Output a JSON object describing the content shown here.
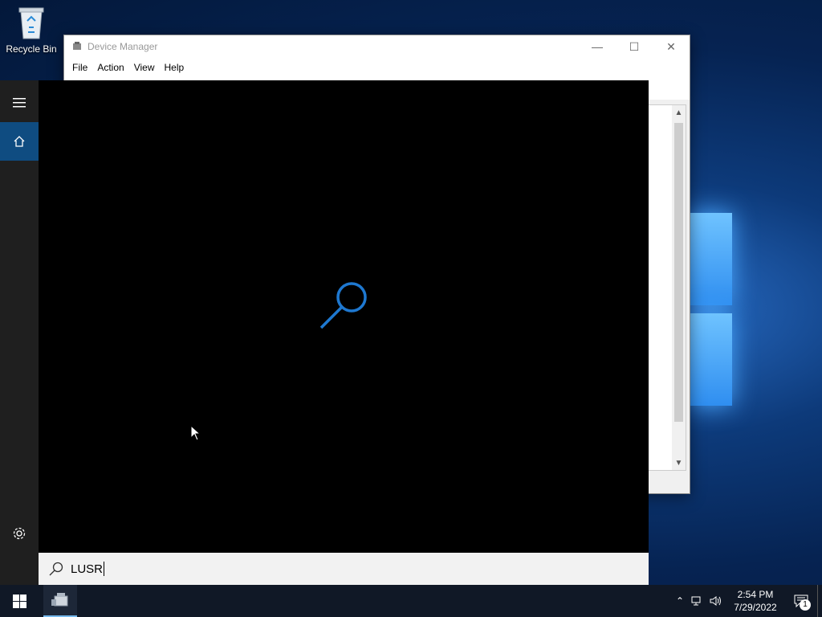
{
  "desktop": {
    "recycle_bin_label": "Recycle Bin"
  },
  "device_manager": {
    "title": "Device Manager",
    "menu": [
      "File",
      "Action",
      "View",
      "Help"
    ]
  },
  "start_panel": {
    "search_query": "LUSR",
    "accent_color": "#0f4c81",
    "search_glyph_color": "#1e78d0"
  },
  "taskbar": {
    "time": "2:54 PM",
    "date": "7/29/2022",
    "notification_count": "1",
    "pinned_apps": [
      "device-manager"
    ]
  }
}
